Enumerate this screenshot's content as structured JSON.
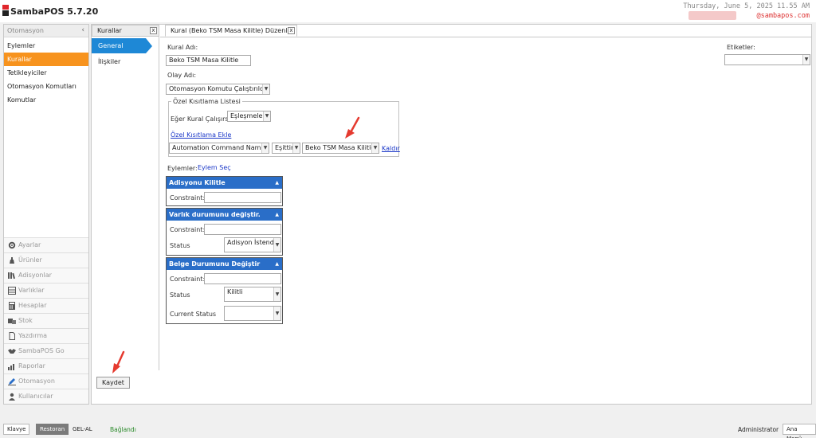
{
  "header": {
    "app_title": "SambaPOS 5.7.20",
    "datetime": "Thursday, June 5, 2025 11.55 AM",
    "user_email": "@sambapos.com"
  },
  "sidebar": {
    "title": "Otomasyon",
    "items": [
      {
        "label": "Eylemler",
        "active": false
      },
      {
        "label": "Kurallar",
        "active": true
      },
      {
        "label": "Tetikleyiciler",
        "active": false
      },
      {
        "label": "Otomasyon Komutları",
        "active": false
      },
      {
        "label": "Komutlar",
        "active": false
      }
    ],
    "nav": [
      {
        "label": "Ayarlar",
        "icon": "gear-icon"
      },
      {
        "label": "Ürünler",
        "icon": "product-icon"
      },
      {
        "label": "Adisyonlar",
        "icon": "books-icon"
      },
      {
        "label": "Varlıklar",
        "icon": "table-icon"
      },
      {
        "label": "Hesaplar",
        "icon": "calculator-icon"
      },
      {
        "label": "Stok",
        "icon": "stock-icon"
      },
      {
        "label": "Yazdırma",
        "icon": "document-icon"
      },
      {
        "label": "SambaPOS Go",
        "icon": "handshake-icon"
      },
      {
        "label": "Raporlar",
        "icon": "bar-chart-icon"
      },
      {
        "label": "Otomasyon",
        "icon": "pencil-icon"
      },
      {
        "label": "Kullanıcılar",
        "icon": "user-icon"
      }
    ]
  },
  "tabs": {
    "list_tab": "Kurallar",
    "editor_tab": "Kural (Beko TSM Masa Kilitle) Düzenle",
    "close_glyph": "x"
  },
  "left_nav": {
    "general": "General Settings",
    "relations": "İlişkiler"
  },
  "form": {
    "rule_name_label": "Kural Adı:",
    "rule_name_value": "Beko TSM Masa Kilitle",
    "event_name_label": "Olay Adı:",
    "event_name_value": "Otomasyon Komutu Çalıştırıldı",
    "tags_label": "Etiketler:",
    "tags_value": "",
    "custom_constraints_title": "Özel Kısıtlama Listesi",
    "if_rule_runs_label": "Eğer Kural Çalışırsa",
    "match_value": "Eşleşmeler",
    "add_constraint_link": "Özel Kısıtlama Ekle",
    "constraint_field": "Automation Command Name",
    "constraint_operator": "Eşittir",
    "constraint_value": "Beko TSM Masa Kilitle",
    "remove_link": "Kaldır",
    "actions_label": "Eylemler:",
    "select_action_link": "Eylem Seç"
  },
  "actions": [
    {
      "title": "Adisyonu Kilitle",
      "constraint_label": "Constraint:",
      "constraint_value": ""
    },
    {
      "title": "Varlık durumunu değiştir.",
      "constraint_label": "Constraint:",
      "constraint_value": "",
      "status_label": "Status",
      "status_value": "Adisyon İstendi"
    },
    {
      "title": "Belge Durumunu Değiştir",
      "constraint_label": "Constraint:",
      "constraint_value": "",
      "status_label": "Status",
      "status_value": "Kilitli",
      "current_status_label": "Current Status",
      "current_status_value": ""
    }
  ],
  "save_button": "Kaydet",
  "statusbar": {
    "keyboard": "Klavye",
    "restaurant": "Restoran",
    "takeaway": "GEL-AL",
    "connected": "Bağlandı",
    "user": "Administrator",
    "main_menu": "Ana Menü"
  },
  "colors": {
    "accent_orange": "#f7931e",
    "accent_blue": "#1e88d6",
    "card_header": "#2a6ec8",
    "connected_green": "#2a8a2a",
    "arrow_red": "#e53a2f"
  }
}
